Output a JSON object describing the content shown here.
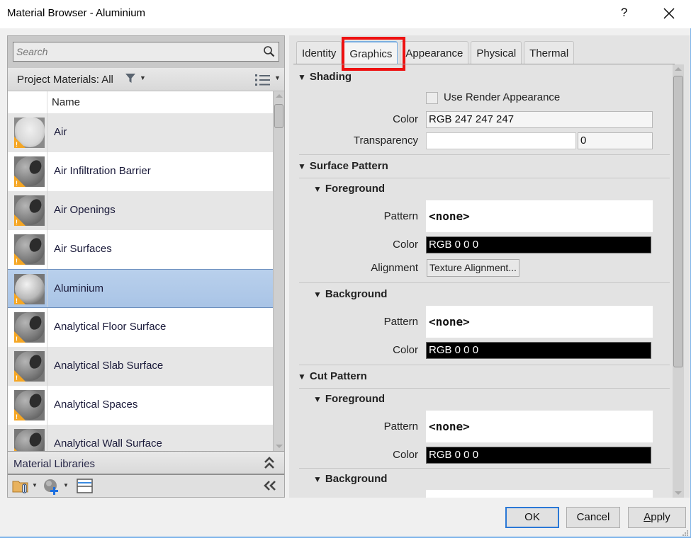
{
  "window": {
    "title": "Material Browser - Aluminium",
    "help_label": "?",
    "close_label": "close"
  },
  "left": {
    "search_placeholder": "Search",
    "filter_label": "Project Materials: All",
    "column_header": "Name",
    "materials": [
      {
        "name": "Air",
        "thumb": "air",
        "warning": true,
        "selected": false
      },
      {
        "name": "Air Infiltration Barrier",
        "thumb": "generic",
        "warning": true,
        "selected": false
      },
      {
        "name": "Air Openings",
        "thumb": "generic",
        "warning": true,
        "selected": false
      },
      {
        "name": "Air Surfaces",
        "thumb": "generic",
        "warning": true,
        "selected": false
      },
      {
        "name": "Aluminium",
        "thumb": "metal",
        "warning": true,
        "selected": true
      },
      {
        "name": "Analytical Floor Surface",
        "thumb": "generic",
        "warning": true,
        "selected": false
      },
      {
        "name": "Analytical Slab Surface",
        "thumb": "generic",
        "warning": true,
        "selected": false
      },
      {
        "name": "Analytical Spaces",
        "thumb": "generic",
        "warning": true,
        "selected": false
      },
      {
        "name": "Analytical Wall Surface",
        "thumb": "generic",
        "warning": true,
        "selected": false
      }
    ],
    "libraries_label": "Material Libraries",
    "toolbar_icons": [
      "library-folder-icon",
      "create-material-icon",
      "material-editor-toggle-icon"
    ]
  },
  "tabs": [
    {
      "label": "Identity",
      "active": false
    },
    {
      "label": "Graphics",
      "active": true,
      "highlighted": true
    },
    {
      "label": "Appearance",
      "active": false
    },
    {
      "label": "Physical",
      "active": false
    },
    {
      "label": "Thermal",
      "active": false
    }
  ],
  "shading": {
    "title": "Shading",
    "use_render_label": "Use Render Appearance",
    "use_render_checked": false,
    "color_label": "Color",
    "color_value": "RGB 247 247 247",
    "transparency_label": "Transparency",
    "transparency_value": "0"
  },
  "surface_pattern": {
    "title": "Surface Pattern",
    "foreground": {
      "title": "Foreground",
      "pattern_label": "Pattern",
      "pattern_value": "<none>",
      "color_label": "Color",
      "color_value": "RGB 0 0 0",
      "alignment_label": "Alignment",
      "alignment_button": "Texture Alignment..."
    },
    "background": {
      "title": "Background",
      "pattern_label": "Pattern",
      "pattern_value": "<none>",
      "color_label": "Color",
      "color_value": "RGB 0 0 0"
    }
  },
  "cut_pattern": {
    "title": "Cut Pattern",
    "foreground": {
      "title": "Foreground",
      "pattern_label": "Pattern",
      "pattern_value": "<none>",
      "color_label": "Color",
      "color_value": "RGB 0 0 0"
    },
    "background": {
      "title": "Background"
    }
  },
  "buttons": {
    "ok": "OK",
    "cancel": "Cancel",
    "apply_accel": "A",
    "apply_rest": "pply"
  },
  "colors": {
    "selection": "#b9d0ec",
    "highlight_box": "#ee1111",
    "default_button_border": "#2a78d6",
    "warning": "#f5a623"
  }
}
